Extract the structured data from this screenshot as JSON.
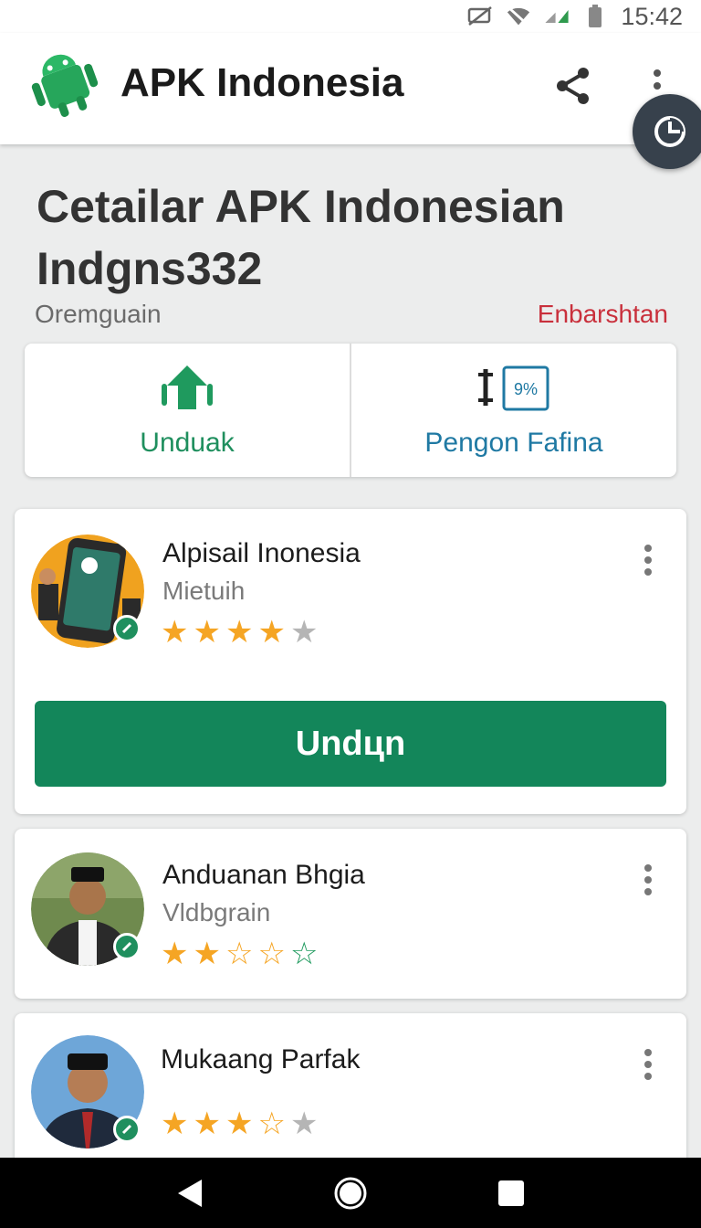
{
  "status_bar": {
    "time": "15:42",
    "icons": [
      "no-sim-icon",
      "wifi-icon",
      "signal-icon",
      "battery-icon"
    ]
  },
  "app_bar": {
    "title": "APK Indonesia",
    "logo": "android-logo-icon",
    "actions": [
      "share-icon",
      "more-vert-icon"
    ]
  },
  "fab": {
    "icon": "clock-icon"
  },
  "header": {
    "title_line1": "Cetailar APK Indonesian",
    "title_line2": "Indgns332",
    "subtitle_left": "Oremguain",
    "subtitle_right": "Enbarshtan"
  },
  "actions": [
    {
      "label": "Unduak",
      "icon": "download-icon"
    },
    {
      "label": "Pengon Fafina",
      "icon": "percent-icon",
      "badge": "9%"
    }
  ],
  "cards": [
    {
      "name": "Alpisail Inonesia",
      "sub": "Mietuih",
      "rating": 4,
      "button": "Undцn"
    },
    {
      "name": "Anduanan Bhgia",
      "sub": "Vldbgrain",
      "rating": 2
    },
    {
      "name": "Mukaang Parfak",
      "sub": "",
      "rating": 3
    }
  ],
  "colors": {
    "primary": "#13865a",
    "accent_red": "#c9303c",
    "star": "#f5a524"
  },
  "nav": [
    "back-icon",
    "home-icon",
    "recents-icon"
  ]
}
